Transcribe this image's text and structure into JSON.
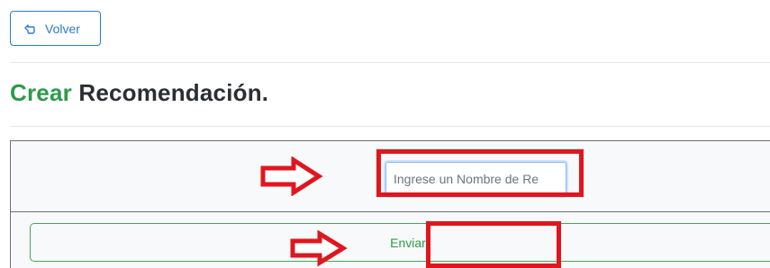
{
  "back_button": {
    "label": "Volver",
    "icon": "back-hand-icon"
  },
  "title": {
    "accent": "Crear",
    "rest": " Recomendación."
  },
  "form": {
    "name_input": {
      "placeholder": "Ingrese un Nombre de Re",
      "value": ""
    },
    "submit_label": "Enviar"
  },
  "colors": {
    "primary": "#2a7bd1",
    "success": "#2e9a4b",
    "annotation": "#e0161f"
  }
}
